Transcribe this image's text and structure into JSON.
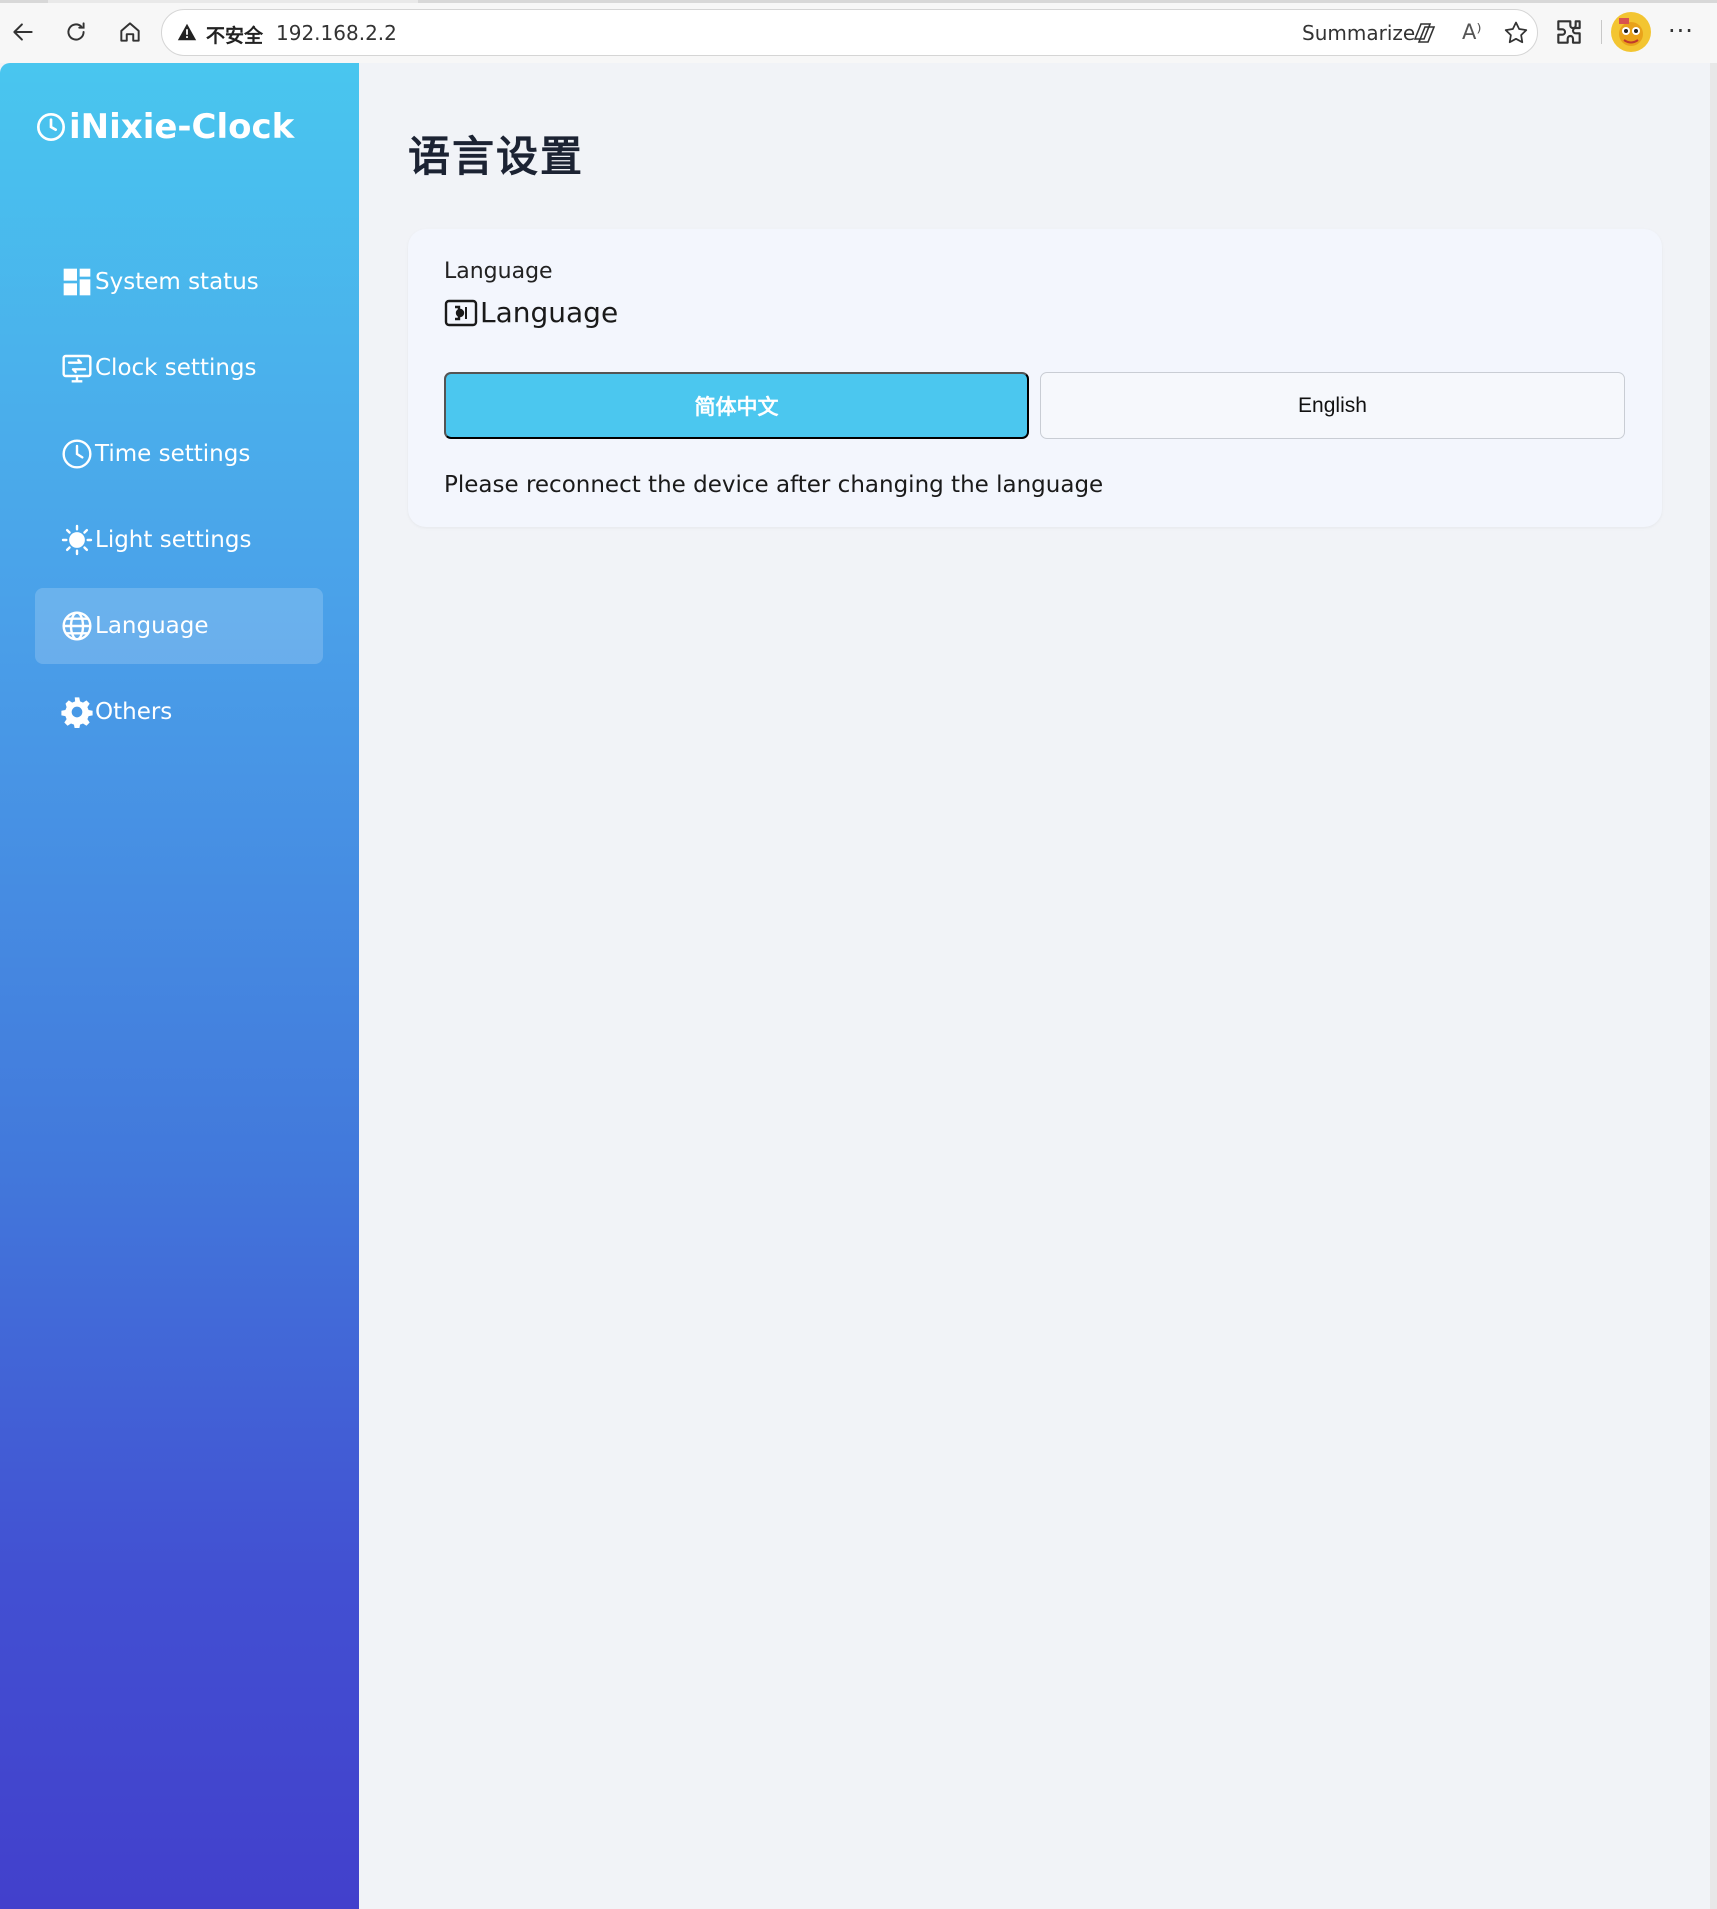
{
  "browser": {
    "insecure_label": "不安全",
    "url": "192.168.2.2",
    "summarize_label": "Summarize",
    "read_aloud_label": "A⁾",
    "more_label": "···"
  },
  "app": {
    "brand": "iNixie-Clock",
    "page_title": "语言设置"
  },
  "sidebar": {
    "items": [
      {
        "label": "System status",
        "icon": "dashboard-icon"
      },
      {
        "label": "Clock settings",
        "icon": "monitor-icon"
      },
      {
        "label": "Time settings",
        "icon": "clock-icon"
      },
      {
        "label": "Light settings",
        "icon": "sun-icon"
      },
      {
        "label": "Language",
        "icon": "globe-icon",
        "active": true
      },
      {
        "label": "Others",
        "icon": "gear-icon"
      }
    ]
  },
  "card": {
    "small_label": "Language",
    "heading": "Language",
    "options": [
      {
        "label": "简体中文",
        "selected": true
      },
      {
        "label": "English",
        "selected": false
      }
    ],
    "note": "Please reconnect the device after changing the language"
  },
  "colors": {
    "accent": "#4bc7ef",
    "sidebar_top": "#49c6ef",
    "sidebar_bottom": "#4240cc",
    "background": "#f1f3f7"
  }
}
